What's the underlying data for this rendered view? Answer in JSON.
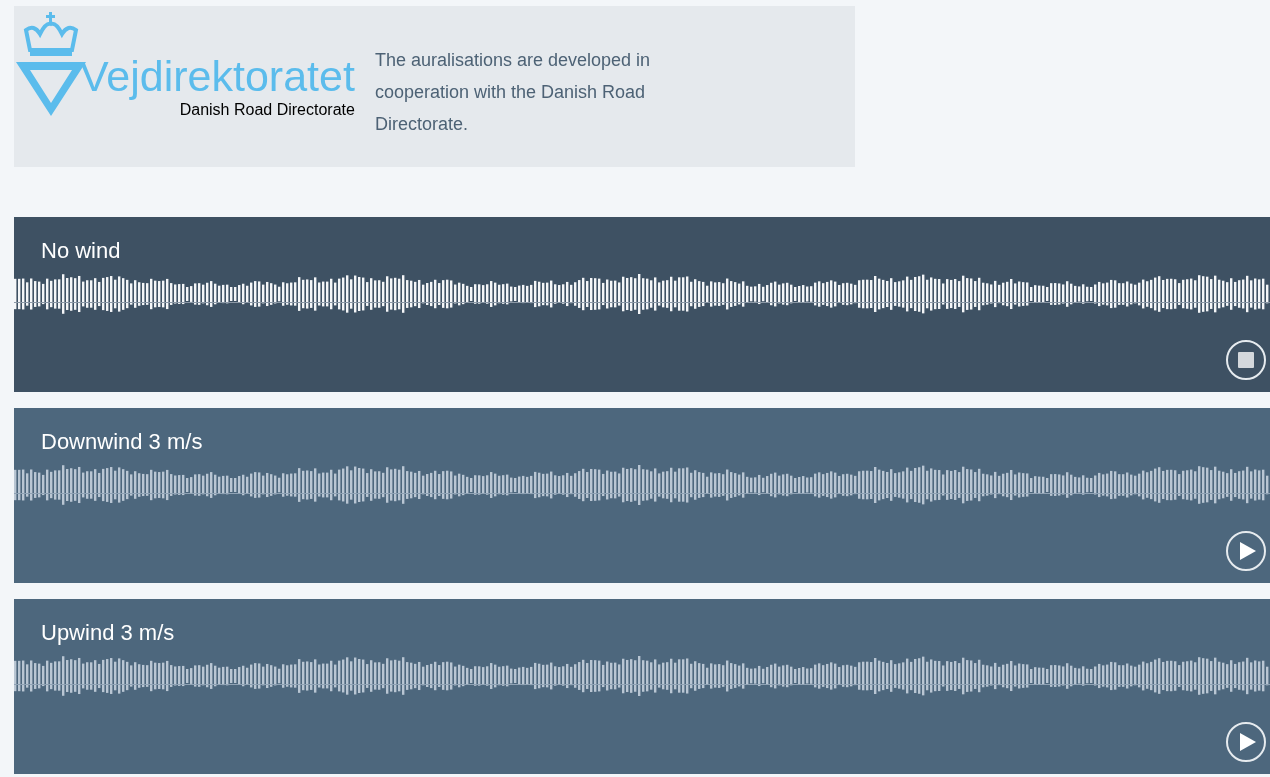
{
  "header": {
    "logo": {
      "name": "Vejdirektoratet",
      "subtitle": "Danish Road Directorate"
    },
    "note": "The auralisations are developed in cooperation with the Danish Road Directorate."
  },
  "tracks": [
    {
      "title": "No wind",
      "playing": true
    },
    {
      "title": "Downwind 3 m/s",
      "playing": false
    },
    {
      "title": "Upwind 3 m/s",
      "playing": false
    }
  ]
}
